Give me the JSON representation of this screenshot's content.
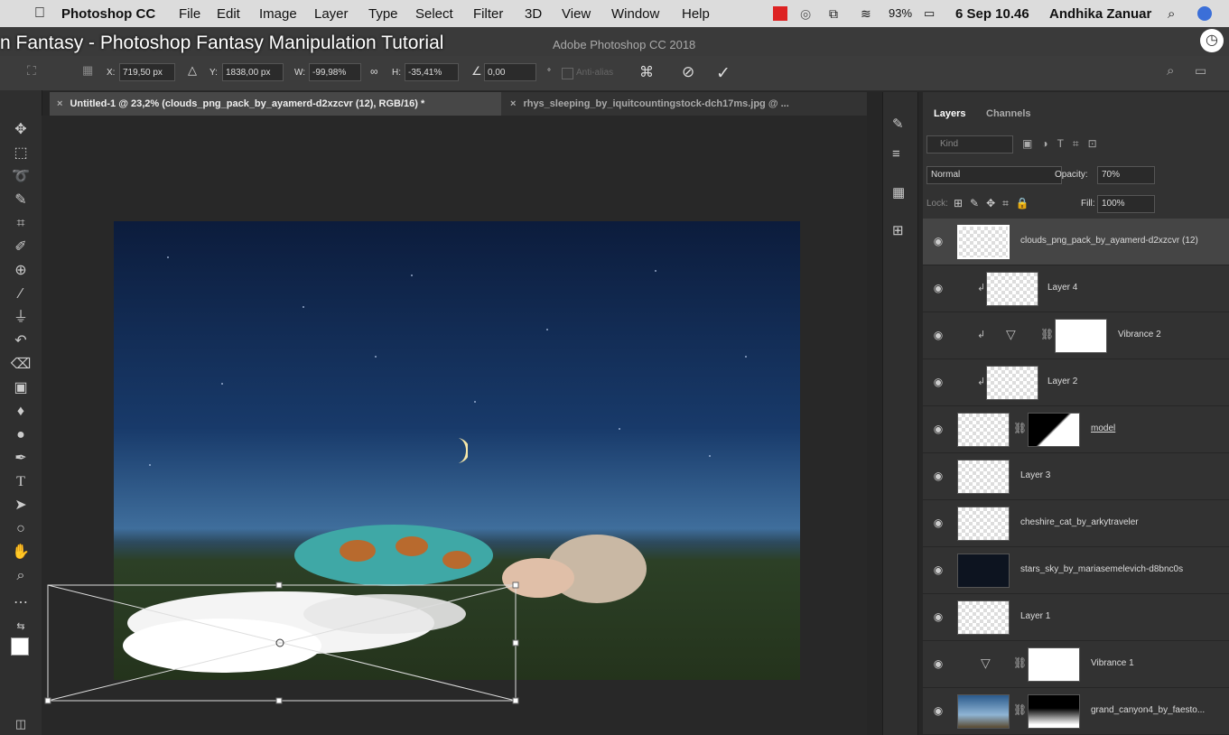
{
  "menubar": {
    "apple": "",
    "app_name": "Photoshop CC",
    "items": [
      "File",
      "Edit",
      "Image",
      "Layer",
      "Type",
      "Select",
      "Filter",
      "3D",
      "View",
      "Window",
      "Help"
    ],
    "battery": "93%",
    "datetime": "6 Sep 10.46",
    "user": "Andhika Zanuar"
  },
  "video_title": "n Fantasy - Photoshop Fantasy Manipulation Tutorial",
  "window_title": "Adobe Photoshop CC 2018",
  "options": {
    "x_label": "X:",
    "x_value": "719,50 px",
    "y_label": "Y:",
    "y_value": "1838,00 px",
    "w_label": "W:",
    "w_value": "-99,98%",
    "h_label": "H:",
    "h_value": "-35,41%",
    "angle_value": "0,00",
    "degree": "°",
    "antialias": "Anti-alias"
  },
  "tabs": [
    {
      "label": "Untitled-1 @ 23,2% (clouds_png_pack_by_ayamerd-d2xzcvr (12), RGB/16) *"
    },
    {
      "label": "rhys_sleeping_by_iquitcountingstock-dch17ms.jpg @ ..."
    }
  ],
  "layers_panel": {
    "tab_layers": "Layers",
    "tab_channels": "Channels",
    "kind_placeholder": "Kind",
    "blend_mode": "Normal",
    "opacity_label": "Opacity:",
    "opacity_value": "70%",
    "lock_label": "Lock:",
    "fill_label": "Fill:",
    "fill_value": "100%",
    "layers": [
      {
        "name": "clouds_png_pack_by_ayamerd-d2xzcvr (12)"
      },
      {
        "name": "Layer 4"
      },
      {
        "name": "Vibrance 2"
      },
      {
        "name": "Layer 2"
      },
      {
        "name": "model"
      },
      {
        "name": "Layer 3"
      },
      {
        "name": "cheshire_cat_by_arkytraveler"
      },
      {
        "name": "stars_sky_by_mariasemelevich-d8bnc0s"
      },
      {
        "name": "Layer 1"
      },
      {
        "name": "Vibrance 1"
      },
      {
        "name": "grand_canyon4_by_faesto..."
      }
    ]
  },
  "colors": {
    "accent": "#1473e6",
    "panel": "#323232",
    "selected_row": "#454545"
  }
}
